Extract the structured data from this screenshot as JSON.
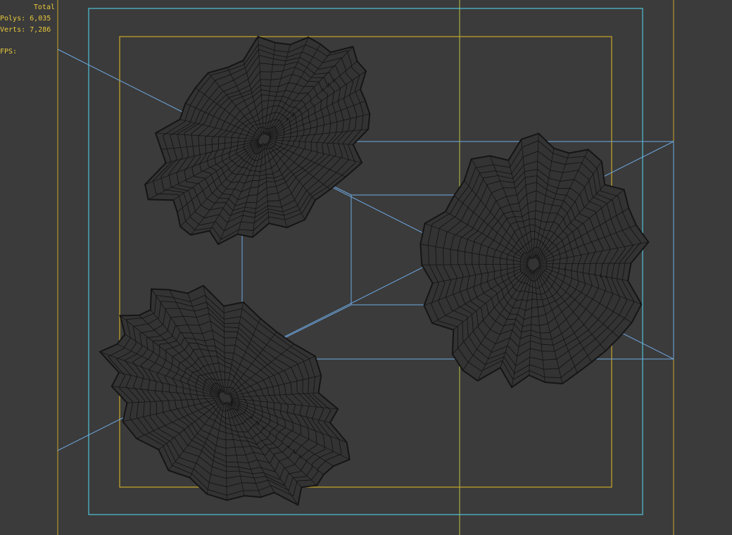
{
  "viewport": {
    "background": "#3b3b3b",
    "stats": {
      "total_label": "Total",
      "polys_label": "Polys:",
      "polys_value": "6,035",
      "verts_label": "Verts:",
      "verts_value": "7,286",
      "fps_label": "FPS:"
    },
    "colors": {
      "stats_text": "#e8c83a",
      "safe_frame_outer": "#4fc3d8",
      "safe_frame_inner": "#c9a62a",
      "guide_vertical": "#b8c43c",
      "camera_frustum": "#6ea8e0",
      "wire": "#151515",
      "mesh_fill": "#333333"
    },
    "objects": [
      "rock-mesh",
      "rock-mesh",
      "rock-mesh"
    ]
  }
}
